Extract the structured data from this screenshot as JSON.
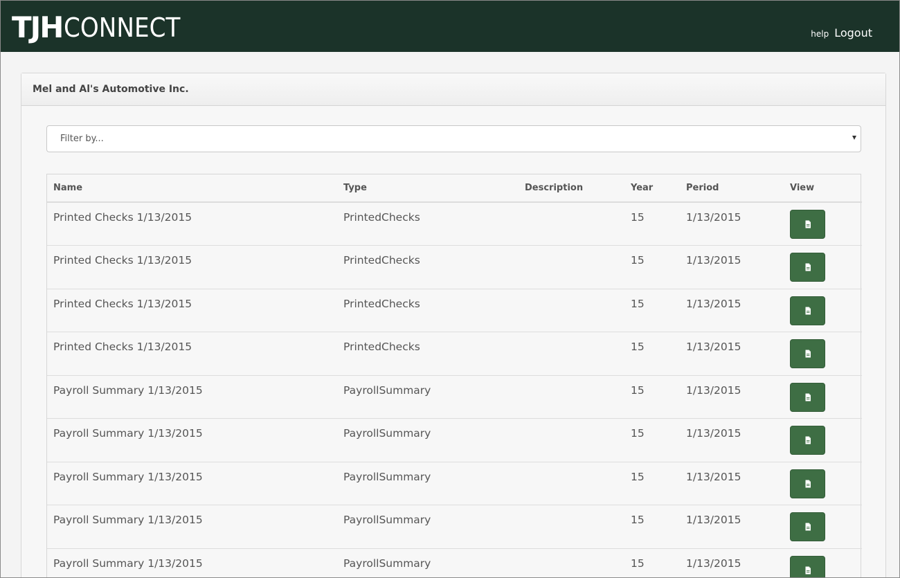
{
  "header": {
    "logo_tjh": "TJH",
    "logo_connect": "CONNECT",
    "help_label": "help",
    "logout_label": "Logout"
  },
  "panel": {
    "title": "Mel and Al's Automotive Inc."
  },
  "filter": {
    "placeholder": "Filter by..."
  },
  "table": {
    "columns": [
      "Name",
      "Type",
      "Description",
      "Year",
      "Period",
      "View"
    ],
    "rows": [
      {
        "name": "Printed Checks 1/13/2015",
        "type": "PrintedChecks",
        "description": "",
        "year": "15",
        "period": "1/13/2015"
      },
      {
        "name": "Printed Checks 1/13/2015",
        "type": "PrintedChecks",
        "description": "",
        "year": "15",
        "period": "1/13/2015"
      },
      {
        "name": "Printed Checks 1/13/2015",
        "type": "PrintedChecks",
        "description": "",
        "year": "15",
        "period": "1/13/2015"
      },
      {
        "name": "Printed Checks 1/13/2015",
        "type": "PrintedChecks",
        "description": "",
        "year": "15",
        "period": "1/13/2015"
      },
      {
        "name": "Payroll Summary 1/13/2015",
        "type": "PayrollSummary",
        "description": "",
        "year": "15",
        "period": "1/13/2015"
      },
      {
        "name": "Payroll Summary 1/13/2015",
        "type": "PayrollSummary",
        "description": "",
        "year": "15",
        "period": "1/13/2015"
      },
      {
        "name": "Payroll Summary 1/13/2015",
        "type": "PayrollSummary",
        "description": "",
        "year": "15",
        "period": "1/13/2015"
      },
      {
        "name": "Payroll Summary 1/13/2015",
        "type": "PayrollSummary",
        "description": "",
        "year": "15",
        "period": "1/13/2015"
      },
      {
        "name": "Payroll Summary 1/13/2015",
        "type": "PayrollSummary",
        "description": "",
        "year": "15",
        "period": "1/13/2015"
      }
    ],
    "view_icon": "document-icon"
  },
  "colors": {
    "header_bg": "#1b3329",
    "button_green": "#3e6e44"
  }
}
